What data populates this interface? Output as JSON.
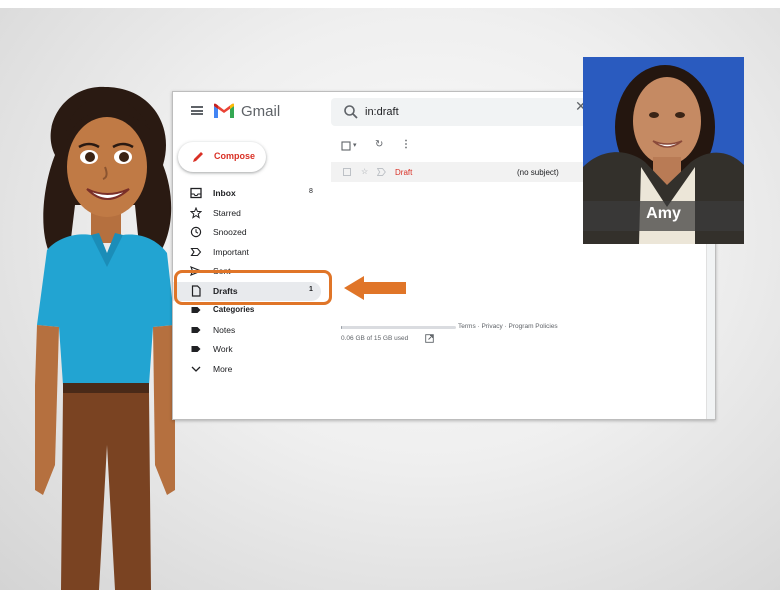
{
  "gmail": {
    "app_name": "Gmail",
    "search_query": "in:draft",
    "compose_label": "Compose",
    "nav": [
      {
        "label": "Inbox",
        "count": "8",
        "icon": "inbox-icon"
      },
      {
        "label": "Starred",
        "count": "",
        "icon": "star-icon"
      },
      {
        "label": "Snoozed",
        "count": "",
        "icon": "clock-icon"
      },
      {
        "label": "Important",
        "count": "",
        "icon": "important-icon"
      },
      {
        "label": "Sent",
        "count": "",
        "icon": "send-icon"
      },
      {
        "label": "Drafts",
        "count": "1",
        "icon": "draft-icon"
      },
      {
        "label": "Categories",
        "count": "",
        "icon": "label-icon"
      },
      {
        "label": "Notes",
        "count": "",
        "icon": "label-icon"
      },
      {
        "label": "Work",
        "count": "",
        "icon": "label-icon"
      },
      {
        "label": "More",
        "count": "",
        "icon": "chevron-down-icon"
      }
    ],
    "message_row": {
      "label": "Draft",
      "subject": "(no subject)"
    },
    "footer_links": "Terms · Privacy · Program Policies",
    "storage_used": "0.06 GB of 15 GB used",
    "storage_fraction": 0.004
  },
  "presenter": {
    "name": "Amy"
  },
  "colors": {
    "accent_orange": "#e07528",
    "gmail_red": "#d93025",
    "photo_bg": "#2a5bbf"
  }
}
